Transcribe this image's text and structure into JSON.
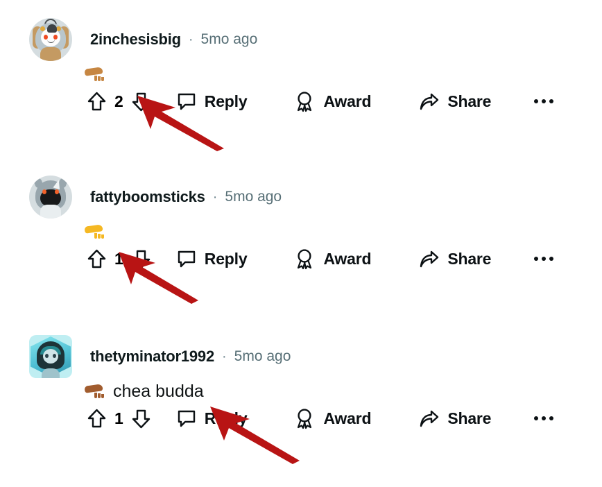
{
  "app": {
    "name": "reddit-comment-thread",
    "background_color": "#ffffff",
    "text_color": "#0f1a1c",
    "muted_text_color": "#576f76",
    "annotation_color": "#b81414"
  },
  "action_labels": {
    "reply": "Reply",
    "award": "Award",
    "share": "Share",
    "more": "More options",
    "upvote": "Upvote",
    "downvote": "Downvote"
  },
  "separator": "·",
  "comments": [
    {
      "username": "2inchesisbig",
      "timestamp": "5mo ago",
      "body_text": "",
      "emoji": "pinching-hand",
      "emoji_skin": "skin-medium",
      "votes": "2",
      "avatar": "snoo-tan-parka"
    },
    {
      "username": "fattyboomsticks",
      "timestamp": "5mo ago",
      "body_text": "",
      "emoji": "pinching-hand",
      "emoji_skin": "skin-yellow",
      "votes": "1",
      "avatar": "snoo-grey-mask"
    },
    {
      "username": "thetyminator1992",
      "timestamp": "5mo ago",
      "body_text": "chea budda",
      "emoji": "pinching-hand",
      "emoji_skin": "skin-brown",
      "votes": "1",
      "avatar": "snoo-teal-hood-nft"
    }
  ],
  "annotations": [
    {
      "name": "arrow-pointing-at-comment-1-body",
      "direction": "up-left"
    },
    {
      "name": "arrow-pointing-at-comment-2-body",
      "direction": "up-left"
    },
    {
      "name": "arrow-pointing-at-comment-3-body",
      "direction": "up-left"
    }
  ]
}
